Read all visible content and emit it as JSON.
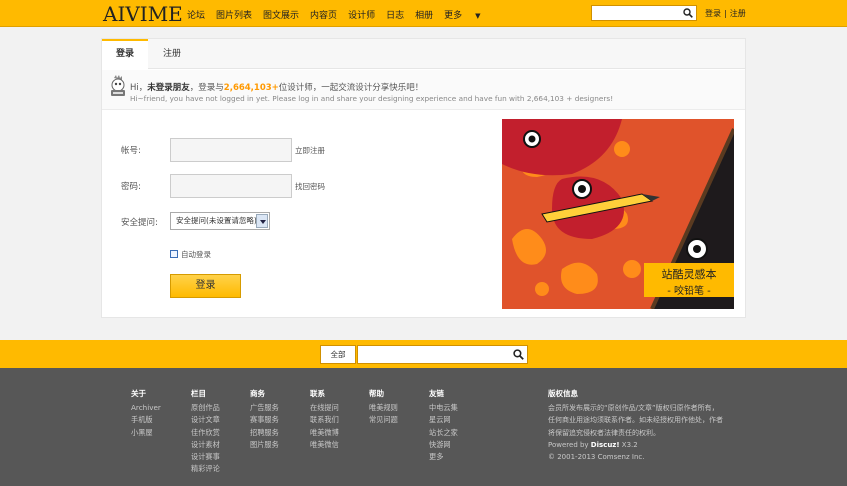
{
  "header": {
    "logo": "AIVIME",
    "nav": [
      "论坛",
      "图片列表",
      "图文展示",
      "内容页",
      "设计师",
      "日志",
      "相册"
    ],
    "more": "更多",
    "search_placeholder": "",
    "login": "登录",
    "separator": "|",
    "register": "注册"
  },
  "tabs": {
    "login": "登录",
    "register": "注册"
  },
  "welcome": {
    "hi": "Hi，",
    "guest": "未登录朋友",
    "mid": "，登录与",
    "count": "2,664,103+",
    "tail": "位设计师，一起交流设计分享快乐吧！",
    "english": "Hi~friend, you have not logged in yet. Please log in and share your designing experience and have fun with 2,664,103 + designers!"
  },
  "form": {
    "account_label": "帐号:",
    "account_link": "立即注册",
    "password_label": "密码:",
    "password_link": "找回密码",
    "question_label": "安全提问:",
    "question_value": "安全提问(未设置请忽略)",
    "auto_login": "自动登录",
    "submit": "登录"
  },
  "promo": {
    "line1": "站酷灵感本",
    "line2": "- 咬铅笔 -"
  },
  "band": {
    "scope": "全部"
  },
  "footer": {
    "columns": [
      {
        "title": "关于",
        "items": [
          "Archiver",
          "手机版",
          "小黑屋"
        ]
      },
      {
        "title": "栏目",
        "items": [
          "原创作品",
          "设计文章",
          "佳作欣赏",
          "设计素材",
          "设计赛事",
          "精彩评论"
        ]
      },
      {
        "title": "商务",
        "items": [
          "广告服务",
          "赛事服务",
          "招聘服务",
          "图片服务"
        ]
      },
      {
        "title": "联系",
        "items": [
          "在线提问",
          "联系我们",
          "唯美微博",
          "唯美微信"
        ]
      },
      {
        "title": "帮助",
        "items": [
          "唯美规则",
          "常见问题"
        ]
      },
      {
        "title": "友链",
        "items": [
          "中电云集",
          "星云网",
          "站长之家",
          "快游网",
          "更多"
        ]
      }
    ],
    "copyright_title": "版权信息",
    "copyright_text": "会员所发布展示的“原创作品/文章”版权归原作者所有，任何商业用途均须联系作者。如未经授权用作他处，作者将保留追究侵权者法律责任的权利。",
    "powered_prefix": "Powered by ",
    "powered_brand": "Discuz!",
    "powered_version": " X3.2",
    "copy_line": "© 2001-2013 Comsenz Inc."
  }
}
